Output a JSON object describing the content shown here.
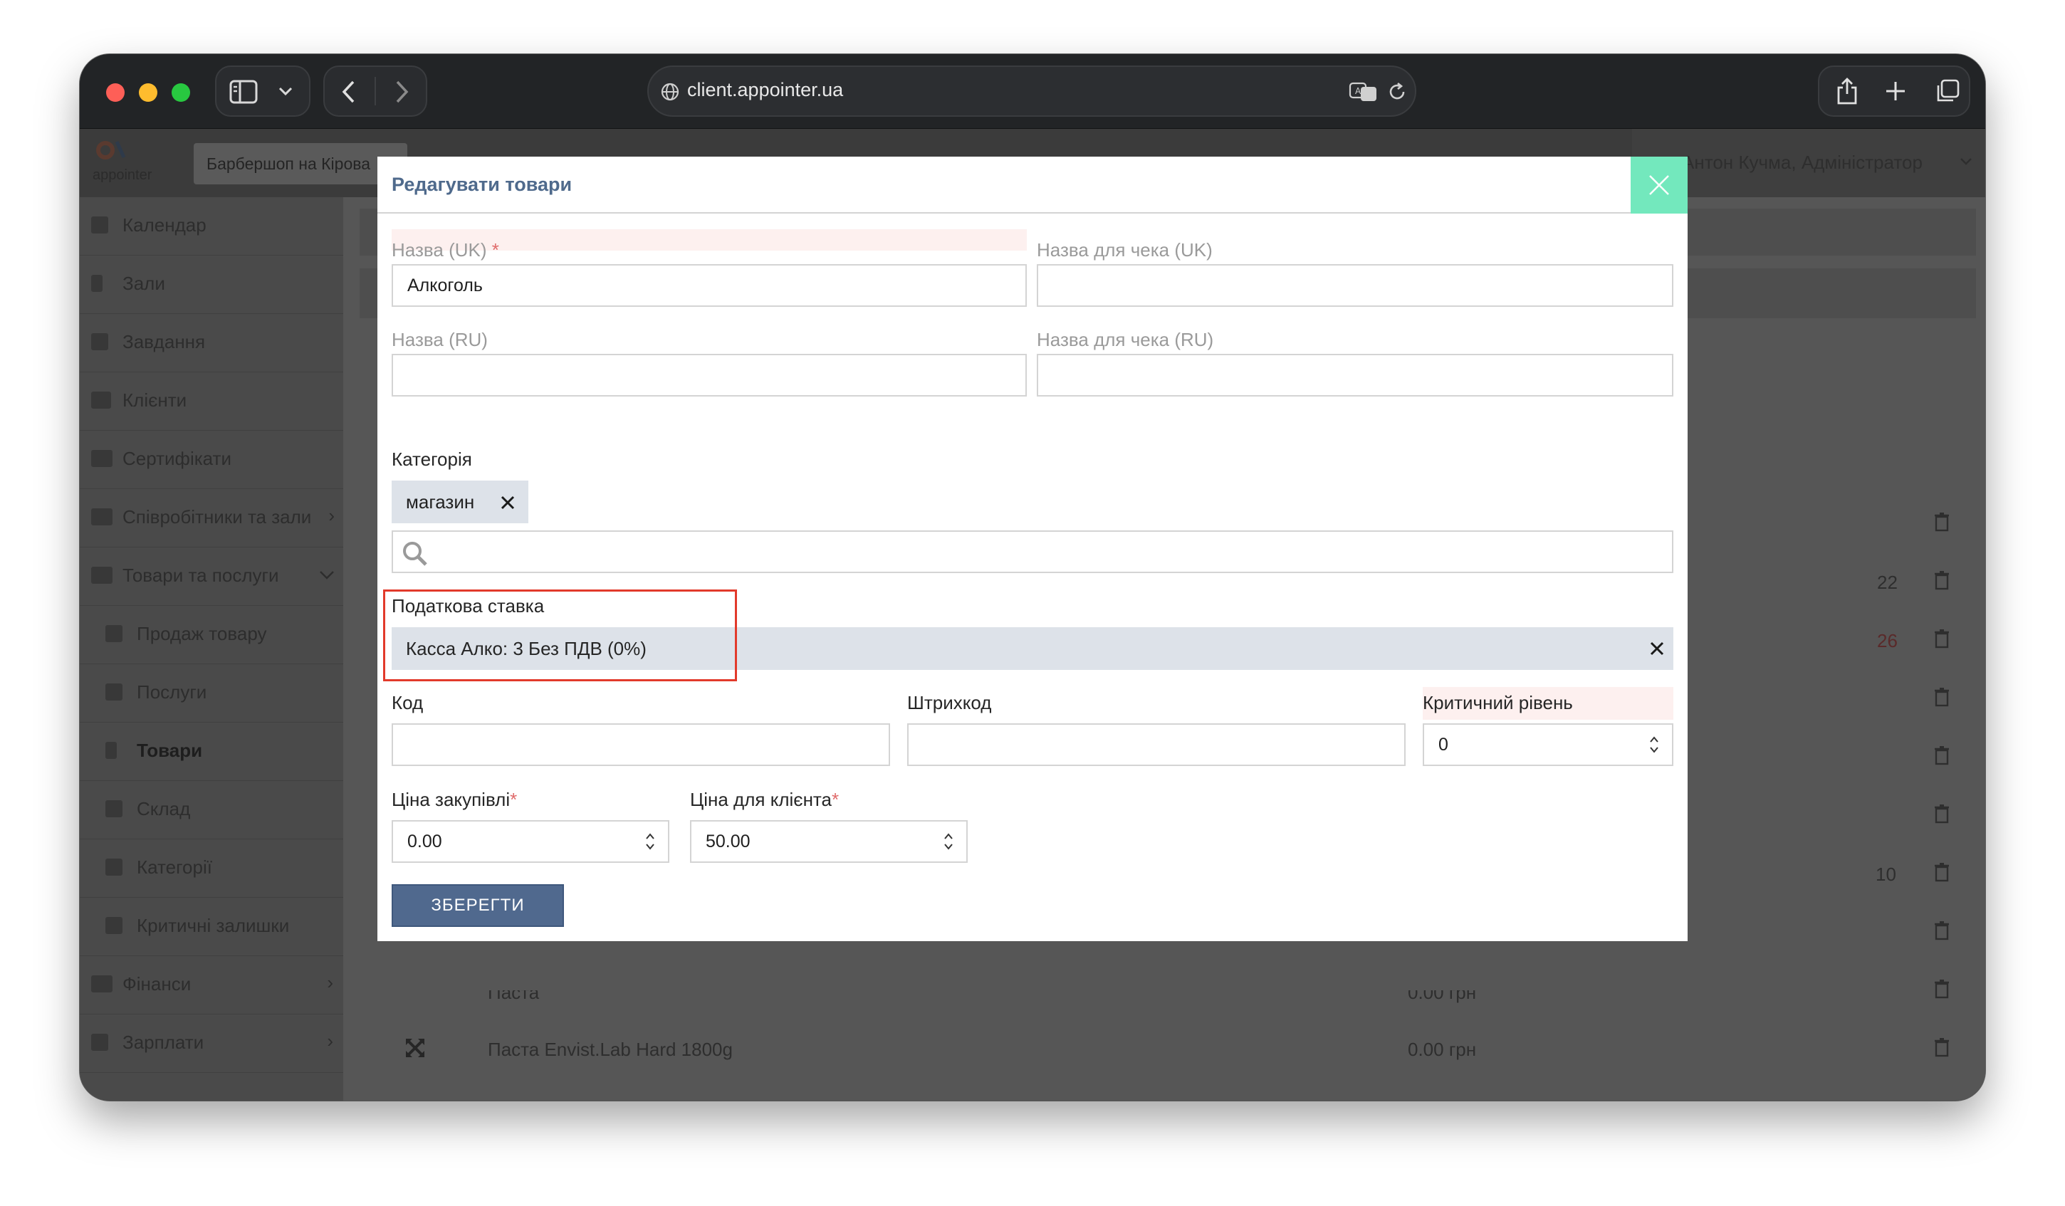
{
  "browser": {
    "url": "client.appointer.ua"
  },
  "app": {
    "logo_text": "appointer",
    "location": "Барбершоп на Кірова",
    "user": "Антон Кучма, Адміністратор"
  },
  "sidebar": {
    "items": [
      {
        "label": "Календар"
      },
      {
        "label": "Зали"
      },
      {
        "label": "Завдання"
      },
      {
        "label": "Клієнти"
      },
      {
        "label": "Сертифікати"
      },
      {
        "label": "Співробітники та зали"
      },
      {
        "label": "Товари та послуги"
      },
      {
        "label": "Продаж товару"
      },
      {
        "label": "Послуги"
      },
      {
        "label": "Товари"
      },
      {
        "label": "Склад"
      },
      {
        "label": "Категорії"
      },
      {
        "label": "Критичні залишки"
      },
      {
        "label": "Фінанси"
      },
      {
        "label": "Зарплати"
      }
    ]
  },
  "background_table": {
    "row_values": [
      "22",
      "26",
      "10"
    ],
    "row_partial": "Паста",
    "row_partial_price": "0.00 грн",
    "last_row_name": "Паста Envist.Lab Hard 1800g",
    "last_row_price": "0.00 грн"
  },
  "modal": {
    "title": "Редагувати товари",
    "name_uk_label": "Назва (UK)",
    "name_uk_value": "Алкоголь",
    "receipt_uk_label": "Назва для чека (UK)",
    "name_ru_label": "Назва (RU)",
    "receipt_ru_label": "Назва для чека (RU)",
    "category_label": "Категорія",
    "category_tag": "магазин",
    "tax_label": "Податкова ставка",
    "tax_value": "Касса Алко: 3 Без ПДВ (0%)",
    "code_label": "Код",
    "barcode_label": "Штрихкод",
    "critical_label": "Критичний рівень",
    "critical_value": "0",
    "purchase_label": "Ціна закупівлі",
    "purchase_value": "0.00",
    "client_price_label": "Ціна для клієнта",
    "client_price_value": "50.00",
    "required_mark": "*",
    "save_label": "ЗБЕРЕГТИ"
  },
  "colors": {
    "accent": "#50698e",
    "close": "#73e8bd",
    "highlight": "#e23a2b"
  }
}
